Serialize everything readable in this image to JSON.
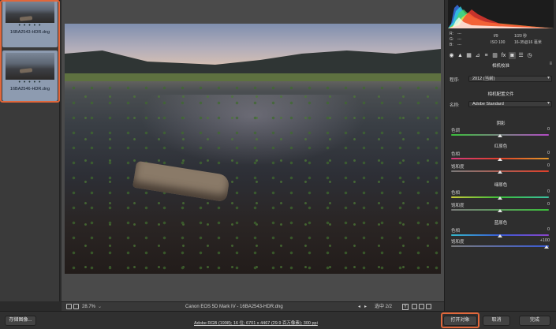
{
  "filmstrip": {
    "items": [
      {
        "name": "16BA2543-HDR.dng",
        "dots": "• • • • •"
      },
      {
        "name": "16BA2546-HDR.dng",
        "dots": "• • • • •"
      }
    ]
  },
  "preview_bar": {
    "zoom": "28.7%",
    "camera": "Canon EOS 5D Mark IV  -  16BA2543-HDR.dng",
    "selection": "选中 2/2",
    "y_label": "Y"
  },
  "histogram": {
    "colors": {
      "red": "#ff3b30",
      "green": "#4cd964",
      "blue": "#3a7bff",
      "yellow": "#ffd93b",
      "cyan": "#33d6e6",
      "white": "#ffffff"
    }
  },
  "meta": {
    "r_label": "R:",
    "g_label": "G:",
    "b_label": "B:",
    "r_value": "---",
    "g_value": "---",
    "b_value": "---",
    "aperture": "f/9",
    "shutter": "1/20 秒",
    "iso": "ISO 100",
    "lens": "16-35@16 毫米"
  },
  "tabs": [
    "◉",
    "▲",
    "▦",
    "⊿",
    "≡",
    "▥",
    "fx",
    "◙",
    "☰",
    "◷"
  ],
  "panel": {
    "section_title": "相机校准",
    "process_label": "程序:",
    "process_value": "2012 (当前)",
    "profile_title": "相机配置文件",
    "profile_label": "名称:",
    "profile_value": "Adobe Standard",
    "shadow_title": "阴影",
    "shadow_tint_label": "色调",
    "shadow_tint_value": "0",
    "red_title": "红原色",
    "red_hue_label": "色相",
    "red_hue_value": "0",
    "red_sat_label": "饱和度",
    "red_sat_value": "0",
    "green_title": "绿原色",
    "green_hue_label": "色相",
    "green_hue_value": "0",
    "green_sat_label": "饱和度",
    "green_sat_value": "0",
    "blue_title": "蓝原色",
    "blue_hue_label": "色相",
    "blue_hue_value": "0",
    "blue_sat_label": "饱和度",
    "blue_sat_value": "+100"
  },
  "bottom": {
    "save_label": "存储图像...",
    "workflow_link": "Adobe RGB (1998); 16 位; 6701 x 4467 (29.9 百万像素); 300 ppi",
    "open_label": "打开对象",
    "cancel_label": "取消",
    "done_label": "完成"
  },
  "accent": "#e0673b"
}
